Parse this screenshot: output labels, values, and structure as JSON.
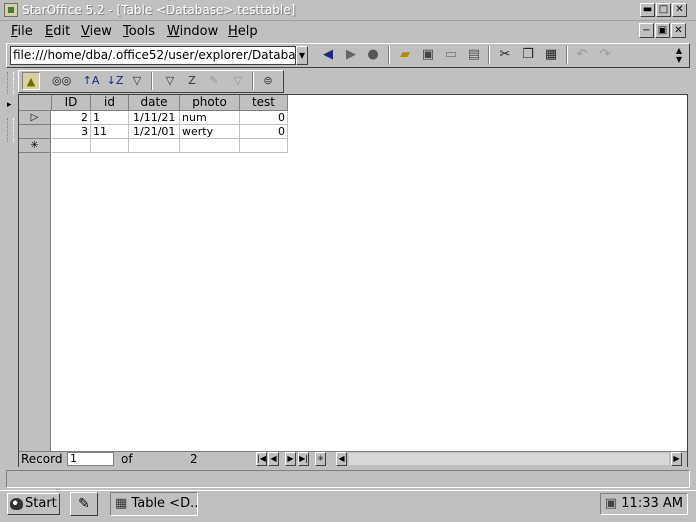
{
  "window": {
    "title": "StarOffice 5.2 - [Table <Database>.testtable]",
    "minimize": "▬",
    "maximize": "□",
    "close": "✕"
  },
  "menu": {
    "items": [
      {
        "label": "File",
        "u": "F",
        "rest": "ile"
      },
      {
        "label": "Edit",
        "u": "E",
        "rest": "dit"
      },
      {
        "label": "View",
        "u": "V",
        "rest": "iew"
      },
      {
        "label": "Tools",
        "u": "T",
        "rest": "ools"
      },
      {
        "label": "Window",
        "u": "W",
        "rest": "indow"
      },
      {
        "label": "Help",
        "u": "H",
        "rest": "elp"
      }
    ],
    "doc_controls": [
      "−",
      "▣",
      "✕"
    ]
  },
  "url_toolbar": {
    "url_value": "file:///home/dba/.office52/user/explorer/Database"
  },
  "table": {
    "columns": [
      "ID",
      "id",
      "date",
      "photo",
      "test"
    ],
    "rows": [
      {
        "ID": "2",
        "id": "1",
        "date": "1/11/21",
        "photo": "num",
        "test": "0"
      },
      {
        "ID": "3",
        "id": "11",
        "date": "1/21/01",
        "photo": "werty",
        "test": "0"
      }
    ],
    "current_row_marker": "▷",
    "new_row_marker": "✳"
  },
  "navigation": {
    "record_label": "Record",
    "record_value": "1",
    "of_label": "of",
    "total": "2"
  },
  "taskbar": {
    "start_label": "Start",
    "task_label": "Table <D...",
    "clock": "11:33 AM"
  }
}
